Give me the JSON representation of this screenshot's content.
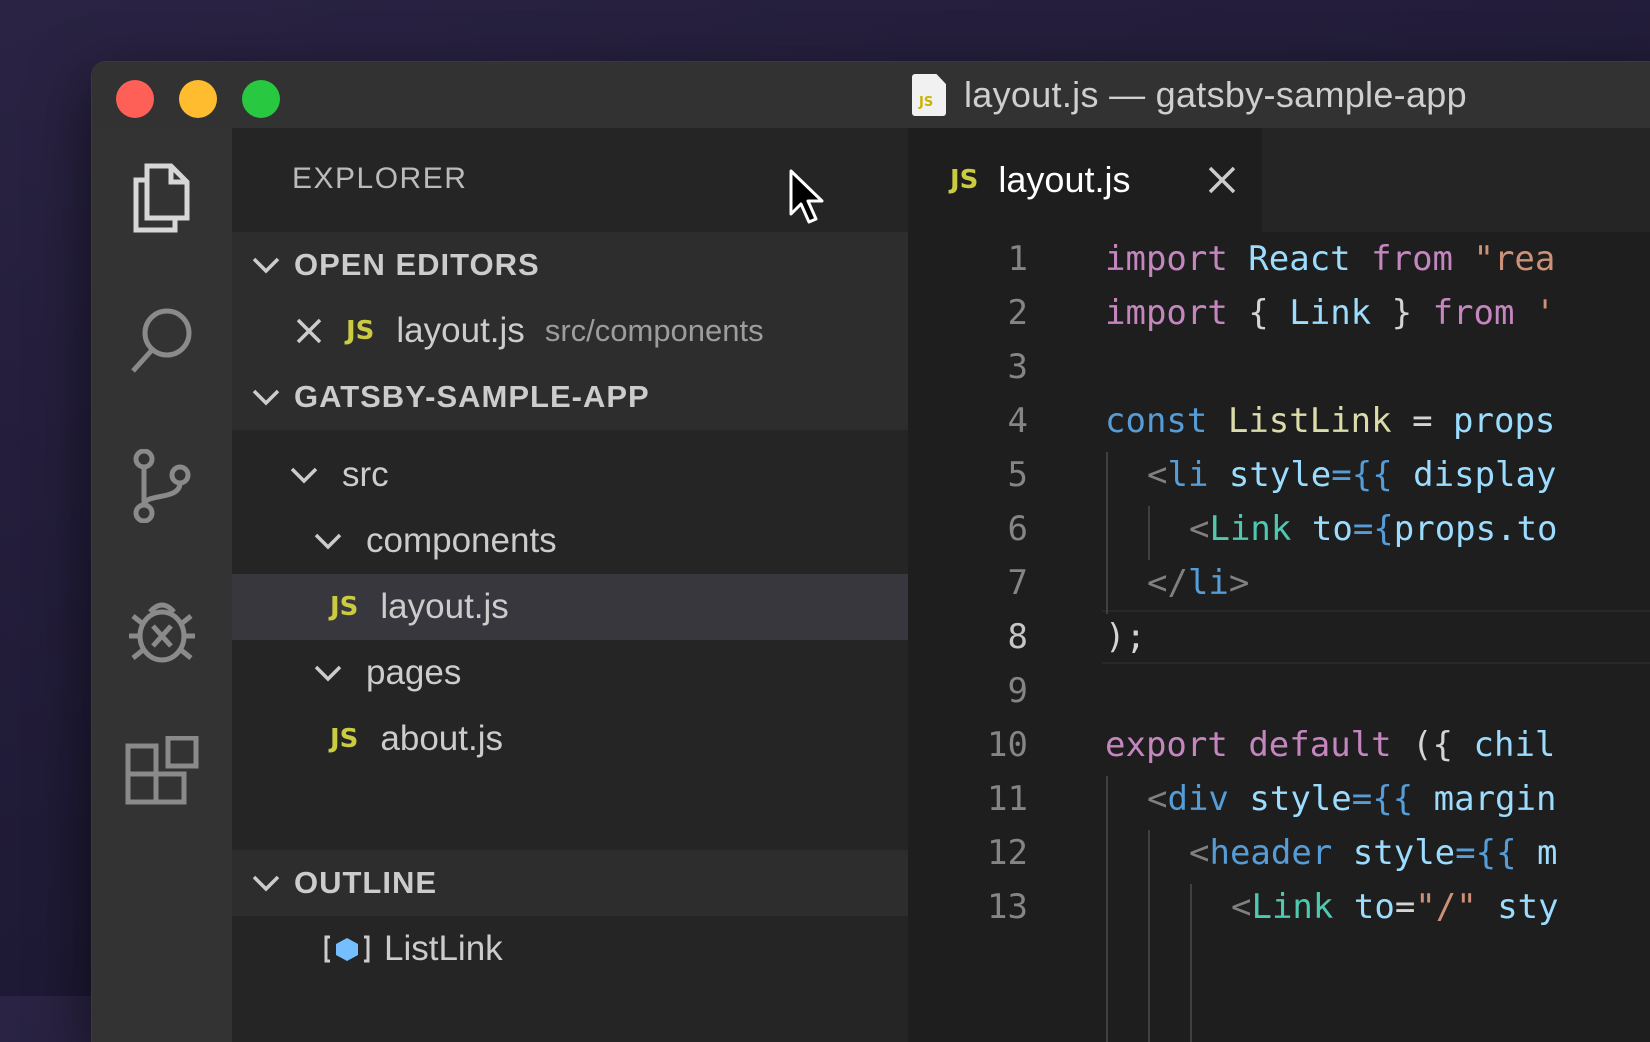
{
  "window": {
    "title": "layout.js — gatsby-sample-app",
    "file_icon_label": "JS"
  },
  "activity_bar": {
    "icons": [
      "files-icon",
      "search-icon",
      "source-control-icon",
      "debug-icon",
      "extensions-icon"
    ]
  },
  "sidebar": {
    "title": "EXPLORER",
    "open_editors": {
      "label": "OPEN EDITORS",
      "items": [
        {
          "name": "layout.js",
          "path": "src/components",
          "badge": "JS"
        }
      ]
    },
    "project": {
      "label": "GATSBY-SAMPLE-APP",
      "tree": [
        {
          "label": "src"
        },
        {
          "label": "components"
        },
        {
          "label": "layout.js",
          "badge": "JS"
        },
        {
          "label": "pages"
        },
        {
          "label": "about.js",
          "badge": "JS"
        }
      ]
    },
    "outline": {
      "label": "OUTLINE",
      "items": [
        {
          "label": "ListLink"
        }
      ]
    }
  },
  "editor": {
    "tab": {
      "name": "layout.js",
      "badge": "JS"
    },
    "active_line": 8,
    "line_numbers": [
      "1",
      "2",
      "3",
      "4",
      "5",
      "6",
      "7",
      "8",
      "9",
      "10",
      "11",
      "12",
      "13"
    ],
    "lines": {
      "l1": {
        "a": "import",
        "b": " React ",
        "c": "from",
        "d": " \"rea"
      },
      "l2": {
        "a": "import",
        "b": " { ",
        "c": "Link",
        "d": " } ",
        "e": "from",
        "f": " '"
      },
      "l4": {
        "a": "const",
        "b": " ",
        "c": "ListLink",
        "d": " = ",
        "e": "props"
      },
      "l5": {
        "a": "<",
        "b": "li",
        "c": " ",
        "d": "style",
        "e": "={{",
        "f": " display"
      },
      "l6": {
        "a": "<",
        "b": "Link",
        "c": " ",
        "d": "to",
        "e": "={",
        "f": "props.to"
      },
      "l7": {
        "a": "</",
        "b": "li",
        "c": ">"
      },
      "l8": {
        "a": ");"
      },
      "l10": {
        "a": "export",
        "b": " ",
        "c": "default",
        "d": " ({ ",
        "e": "chil"
      },
      "l11": {
        "a": "<",
        "b": "div",
        "c": " ",
        "d": "style",
        "e": "={{",
        "f": " margin"
      },
      "l12": {
        "a": "<",
        "b": "header",
        "c": " ",
        "d": "style",
        "e": "={{",
        "f": " m"
      },
      "l13": {
        "a": "<",
        "b": "Link",
        "c": " ",
        "d": "to",
        "e": "=",
        "f": "\"/\"",
        "g": " sty"
      }
    }
  }
}
